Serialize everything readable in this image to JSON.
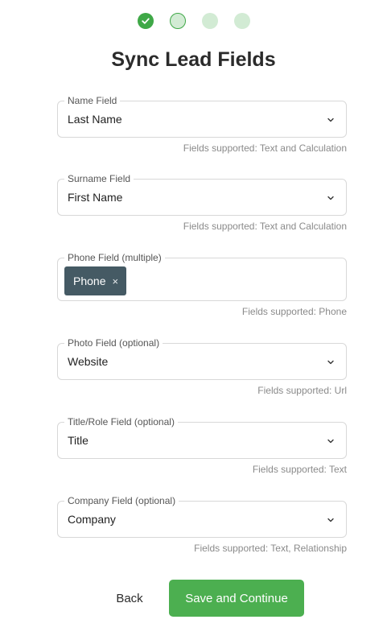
{
  "stepper": {
    "steps": [
      {
        "state": "completed",
        "icon": "check-icon"
      },
      {
        "state": "current"
      },
      {
        "state": "upcoming"
      },
      {
        "state": "upcoming"
      }
    ],
    "colors": {
      "done": "#3fa847",
      "pending": "#d2ebd4"
    }
  },
  "title": "Sync Lead Fields",
  "fields": {
    "name": {
      "label": "Name Field",
      "value": "Last Name",
      "help": "Fields supported: Text and Calculation"
    },
    "surname": {
      "label": "Surname Field",
      "value": "First Name",
      "help": "Fields supported: Text and Calculation"
    },
    "phone": {
      "label": "Phone Field (multiple)",
      "chips": [
        "Phone"
      ],
      "remove_symbol": "×",
      "help": "Fields supported: Phone"
    },
    "photo": {
      "label": "Photo Field (optional)",
      "value": "Website",
      "help": "Fields supported: Url"
    },
    "title_role": {
      "label": "Title/Role Field (optional)",
      "value": "Title",
      "help": "Fields supported: Text"
    },
    "company": {
      "label": "Company Field (optional)",
      "value": "Company",
      "help": "Fields supported: Text, Relationship"
    }
  },
  "actions": {
    "back_label": "Back",
    "save_label": "Save and Continue",
    "save_color": "#4caf50"
  },
  "icons": {
    "dropdown": "chevron-down-icon",
    "completed_step": "check-icon"
  }
}
